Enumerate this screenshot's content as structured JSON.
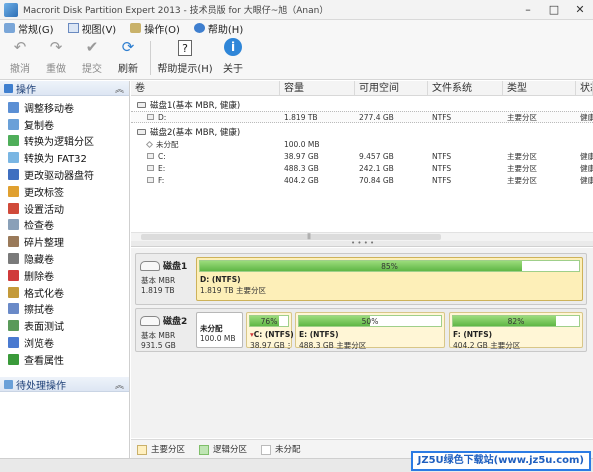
{
  "window": {
    "title": "Macrorit Disk Partition Expert 2013 - 技术员版 for 大眼仔~旭（Anan）"
  },
  "menu": [
    {
      "label": "常规(G)"
    },
    {
      "label": "视图(V)"
    },
    {
      "label": "操作(O)"
    },
    {
      "label": "帮助(H)"
    }
  ],
  "toolbar": {
    "undo": "撤消",
    "redo": "重做",
    "commit": "提交",
    "refresh": "刷新",
    "help_tips": "帮助提示(H)",
    "about": "关于"
  },
  "sidebar": {
    "title": "操作",
    "items": [
      {
        "label": "调整移动卷",
        "color": "#5b8fd4"
      },
      {
        "label": "复制卷",
        "color": "#6aa0d8"
      },
      {
        "label": "转换为逻辑分区",
        "color": "#4fae5a"
      },
      {
        "label": "转换为 FAT32",
        "color": "#7ab6e3"
      },
      {
        "label": "更改驱动器盘符",
        "color": "#3f6fc0"
      },
      {
        "label": "更改标签",
        "color": "#e0a030"
      },
      {
        "label": "设置活动",
        "color": "#d04a3a"
      },
      {
        "label": "检查卷",
        "color": "#8aa0b8"
      },
      {
        "label": "碎片整理",
        "color": "#9a7a5a"
      },
      {
        "label": "隐藏卷",
        "color": "#7a7a7a"
      },
      {
        "label": "删除卷",
        "color": "#d03a3a"
      },
      {
        "label": "格式化卷",
        "color": "#c49a3a"
      },
      {
        "label": "擦拭卷",
        "color": "#6a8ac8"
      },
      {
        "label": "表面测试",
        "color": "#5a9a5a"
      },
      {
        "label": "浏览卷",
        "color": "#4a7ad0"
      },
      {
        "label": "查看属性",
        "color": "#3a9a3a"
      }
    ],
    "pending_title": "待处理操作"
  },
  "grid": {
    "columns": [
      "卷",
      "容量",
      "可用空间",
      "文件系统",
      "类型",
      "状态"
    ],
    "disks": [
      {
        "label": "磁盘1(基本 MBR, 健康)",
        "rows": [
          {
            "name": "D:",
            "capacity": "1.819 TB",
            "free": "277.4 GB",
            "fs": "NTFS",
            "type": "主要分区",
            "status": "健康"
          }
        ]
      },
      {
        "label": "磁盘2(基本 MBR, 健康)",
        "rows": [
          {
            "name": "未分配",
            "capacity": "100.0 MB",
            "free": "",
            "fs": "",
            "type": "",
            "status": ""
          },
          {
            "name": "C:",
            "capacity": "38.97 GB",
            "free": "9.457 GB",
            "fs": "NTFS",
            "type": "主要分区",
            "status": "健康"
          },
          {
            "name": "E:",
            "capacity": "488.3 GB",
            "free": "242.1 GB",
            "fs": "NTFS",
            "type": "主要分区",
            "status": "健康"
          },
          {
            "name": "F:",
            "capacity": "404.2 GB",
            "free": "70.84 GB",
            "fs": "NTFS",
            "type": "主要分区",
            "status": "健康"
          }
        ]
      }
    ]
  },
  "map": {
    "disk1": {
      "title": "磁盘1",
      "scheme": "基本 MBR",
      "size": "1.819 TB",
      "d": {
        "name": "D: (NTFS)",
        "desc": "1.819 TB 主要分区",
        "used": 0.85,
        "pct": "85%"
      }
    },
    "disk2": {
      "title": "磁盘2",
      "scheme": "基本 MBR",
      "size": "931.5 GB",
      "unalloc": {
        "name": "未分配",
        "desc": "100.0 MB"
      },
      "c": {
        "name": "C: (NTFS)",
        "desc": "38.97 GB 主",
        "used": 0.76,
        "pct": "76%"
      },
      "e": {
        "name": "E: (NTFS)",
        "desc": "488.3 GB 主要分区",
        "used": 0.5,
        "pct": "50%"
      },
      "f": {
        "name": "F: (NTFS)",
        "desc": "404.2 GB 主要分区",
        "used": 0.82,
        "pct": "82%"
      }
    }
  },
  "legend": {
    "primary": "主要分区",
    "logical": "逻辑分区",
    "unallocated": "未分配"
  },
  "watermark": "JZ5U绿色下载站(www.jz5u.com)"
}
